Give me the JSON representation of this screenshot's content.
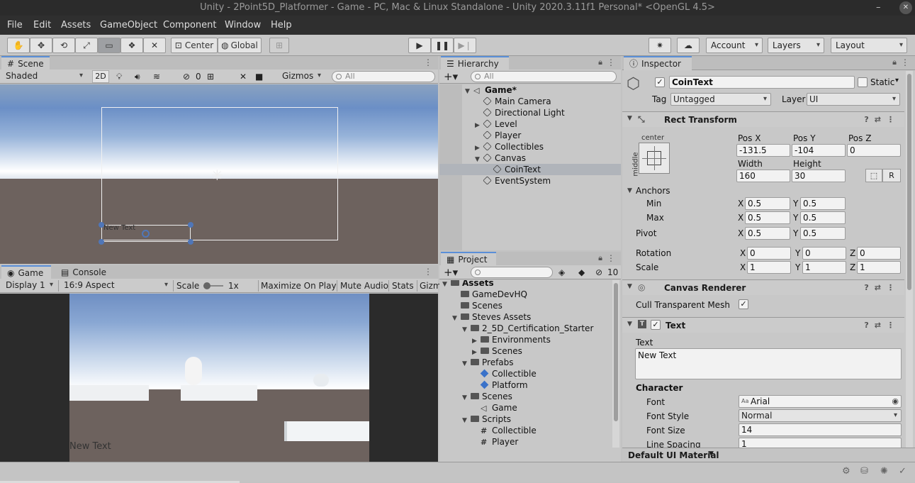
{
  "window": {
    "title": "Unity - 2Point5D_Platformer - Game - PC, Mac & Linux Standalone - Unity 2020.3.11f1 Personal* <OpenGL 4.5>",
    "minimize": "–",
    "close": "✕"
  },
  "menu": [
    "File",
    "Edit",
    "Assets",
    "GameObject",
    "Component",
    "Window",
    "Help"
  ],
  "toolbar": {
    "pivot_mode": "Center",
    "pivot_space": "Global",
    "account": "Account",
    "layers": "Layers",
    "layout": "Layout"
  },
  "scene": {
    "tab": "Scene",
    "shading": "Shaded",
    "mode_2d": "2D",
    "hidden_count": "0",
    "gizmos": "Gizmos",
    "search_placeholder": "All",
    "canvas_text": "New Text"
  },
  "game": {
    "tab": "Game",
    "console_tab": "Console",
    "display": "Display 1",
    "aspect": "16:9 Aspect",
    "scale_label": "Scale",
    "scale_value": "1x",
    "maximize": "Maximize On Play",
    "mute": "Mute Audio",
    "stats": "Stats",
    "gizmos": "Gizm",
    "overlay_text": "New Text"
  },
  "hierarchy": {
    "tab": "Hierarchy",
    "search_placeholder": "All",
    "items": [
      {
        "label": "Game*",
        "depth": 0,
        "fold": "▼",
        "icon": "unity-scene-icon",
        "bold": true
      },
      {
        "label": "Main Camera",
        "depth": 1,
        "fold": "",
        "icon": "gameobject-icon"
      },
      {
        "label": "Directional Light",
        "depth": 1,
        "fold": "",
        "icon": "gameobject-icon"
      },
      {
        "label": "Level",
        "depth": 1,
        "fold": "▶",
        "icon": "gameobject-icon"
      },
      {
        "label": "Player",
        "depth": 1,
        "fold": "",
        "icon": "gameobject-icon"
      },
      {
        "label": "Collectibles",
        "depth": 1,
        "fold": "▶",
        "icon": "gameobject-icon"
      },
      {
        "label": "Canvas",
        "depth": 1,
        "fold": "▼",
        "icon": "gameobject-icon"
      },
      {
        "label": "CoinText",
        "depth": 2,
        "fold": "",
        "icon": "gameobject-icon",
        "selected": true
      },
      {
        "label": "EventSystem",
        "depth": 1,
        "fold": "",
        "icon": "gameobject-icon"
      }
    ]
  },
  "project": {
    "tab": "Project",
    "hidden_count": "10",
    "items": [
      {
        "label": "Assets",
        "depth": 0,
        "fold": "▼",
        "icon": "folder-icon",
        "bold": true
      },
      {
        "label": "GameDevHQ",
        "depth": 1,
        "fold": "",
        "icon": "folder-icon"
      },
      {
        "label": "Scenes",
        "depth": 1,
        "fold": "",
        "icon": "folder-icon"
      },
      {
        "label": "Steves Assets",
        "depth": 1,
        "fold": "▼",
        "icon": "folder-icon"
      },
      {
        "label": "2_5D_Certification_Starter",
        "depth": 2,
        "fold": "▼",
        "icon": "folder-icon"
      },
      {
        "label": "Environments",
        "depth": 3,
        "fold": "▶",
        "icon": "folder-icon"
      },
      {
        "label": "Scenes",
        "depth": 3,
        "fold": "▶",
        "icon": "folder-icon"
      },
      {
        "label": "Prefabs",
        "depth": 2,
        "fold": "▼",
        "icon": "folder-icon"
      },
      {
        "label": "Collectible",
        "depth": 3,
        "fold": "",
        "icon": "prefab-icon"
      },
      {
        "label": "Platform",
        "depth": 3,
        "fold": "",
        "icon": "prefab-icon"
      },
      {
        "label": "Scenes",
        "depth": 2,
        "fold": "▼",
        "icon": "folder-icon"
      },
      {
        "label": "Game",
        "depth": 3,
        "fold": "",
        "icon": "unity-scene-icon"
      },
      {
        "label": "Scripts",
        "depth": 2,
        "fold": "▼",
        "icon": "folder-icon"
      },
      {
        "label": "Collectible",
        "depth": 3,
        "fold": "",
        "icon": "script-icon"
      },
      {
        "label": "Player",
        "depth": 3,
        "fold": "",
        "icon": "script-icon"
      }
    ]
  },
  "inspector": {
    "tab": "Inspector",
    "name": "CoinText",
    "static_label": "Static",
    "tag_label": "Tag",
    "tag_value": "Untagged",
    "layer_label": "Layer",
    "layer_value": "UI",
    "rect_transform": {
      "title": "Rect Transform",
      "anchor_h": "center",
      "anchor_v": "middle",
      "pos_x_label": "Pos X",
      "pos_y_label": "Pos Y",
      "pos_z_label": "Pos Z",
      "pos_x": "-131.5",
      "pos_y": "-104",
      "pos_z": "0",
      "width_label": "Width",
      "height_label": "Height",
      "width": "160",
      "height": "30",
      "r_button": "R",
      "anchors_label": "Anchors",
      "min_label": "Min",
      "max_label": "Max",
      "pivot_label": "Pivot",
      "x_label": "X",
      "y_label": "Y",
      "z_label": "Z",
      "min_x": "0.5",
      "min_y": "0.5",
      "max_x": "0.5",
      "max_y": "0.5",
      "pivot_x": "0.5",
      "pivot_y": "0.5",
      "rotation_label": "Rotation",
      "rot_x": "0",
      "rot_y": "0",
      "rot_z": "0",
      "scale_label": "Scale",
      "scale_x": "1",
      "scale_y": "1",
      "scale_z": "1"
    },
    "canvas_renderer": {
      "title": "Canvas Renderer",
      "cull_label": "Cull Transparent Mesh",
      "cull_checked": "✓"
    },
    "text": {
      "title": "Text",
      "text_label": "Text",
      "text_value": "New Text",
      "character_label": "Character",
      "font_label": "Font",
      "font_value": "Arial",
      "font_style_label": "Font Style",
      "font_style_value": "Normal",
      "font_size_label": "Font Size",
      "font_size_value": "14",
      "line_spacing_label": "Line Spacing",
      "line_spacing_value": "1"
    },
    "material": "Default UI Material"
  }
}
